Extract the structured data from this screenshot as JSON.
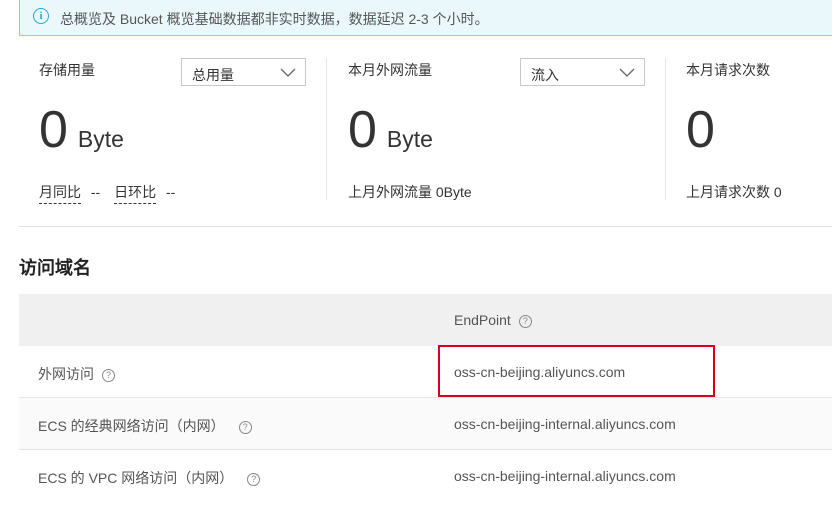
{
  "notice": {
    "text": "总概览及 Bucket 概览基础数据都非实时数据，数据延迟 2-3 个小时。",
    "icon": "info-icon"
  },
  "metrics": {
    "storage": {
      "title": "存储用量",
      "select_value": "总用量",
      "value": "0",
      "unit": "Byte",
      "yoy_label": "月同比",
      "yoy_value": "--",
      "mom_label": "日环比",
      "mom_value": "--"
    },
    "traffic": {
      "title": "本月外网流量",
      "select_value": "流入",
      "value": "0",
      "unit": "Byte",
      "last_month": "上月外网流量  0Byte"
    },
    "requests": {
      "title": "本月请求次数",
      "value": "0",
      "last_month": "上月请求次数  0"
    }
  },
  "domains": {
    "title": "访问域名",
    "column_header": "EndPoint",
    "rows": [
      {
        "label": "外网访问",
        "endpoint": "oss-cn-beijing.aliyuncs.com"
      },
      {
        "label": "ECS 的经典网络访问（内网）",
        "endpoint": "oss-cn-beijing-internal.aliyuncs.com"
      },
      {
        "label": "ECS 的 VPC 网络访问（内网）",
        "endpoint": "oss-cn-beijing-internal.aliyuncs.com"
      }
    ]
  },
  "colors": {
    "highlight": "#d9001b",
    "notice_border": "#7ad4ea",
    "notice_bg": "#eaf8fc"
  }
}
